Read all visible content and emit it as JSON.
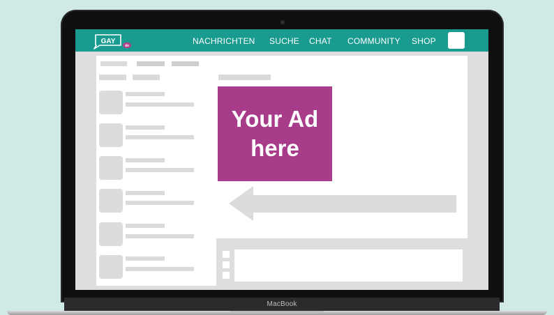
{
  "device": {
    "brand_label": "MacBook"
  },
  "nav": {
    "logo": {
      "text": "GAY",
      "badge_text": "de"
    },
    "items": [
      {
        "label": "NACHRICHTEN"
      },
      {
        "label": "SUCHE"
      },
      {
        "label": "CHAT"
      },
      {
        "label": "COMMUNITY"
      },
      {
        "label": "SHOP"
      }
    ]
  },
  "ad": {
    "text": "Your Ad\nhere"
  },
  "colors": {
    "background": "#cfe9e6",
    "nav": "#1a9b8f",
    "ad": "#a83c8a",
    "placeholder": "#dadada"
  },
  "icons": {
    "arrow": "arrow-left-icon",
    "logo": "speech-bubble-logo-icon"
  }
}
